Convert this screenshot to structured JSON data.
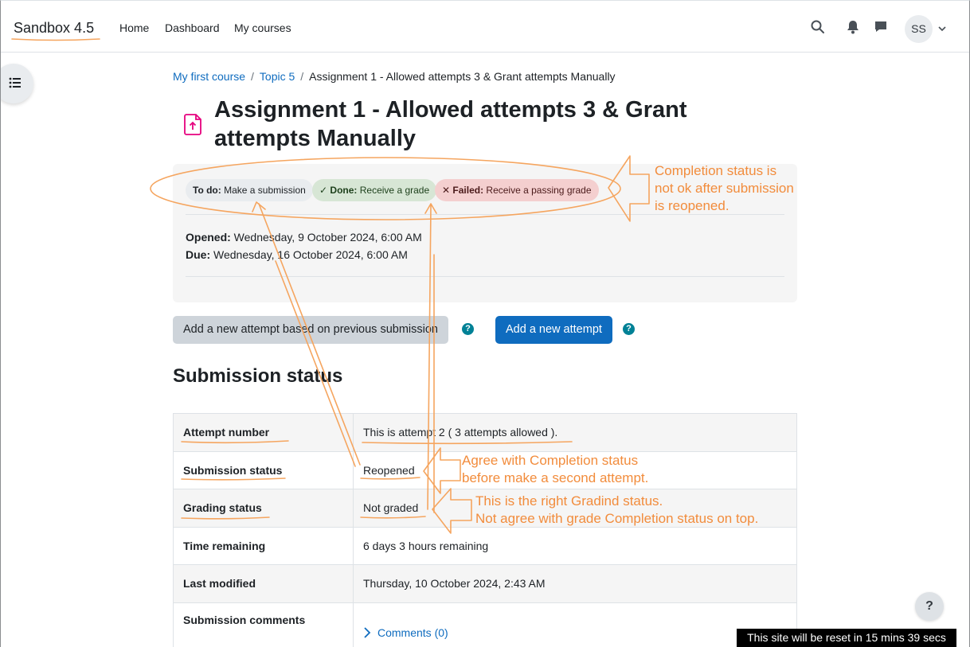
{
  "navbar": {
    "brand": "Sandbox 4.5",
    "links": [
      "Home",
      "Dashboard",
      "My courses"
    ],
    "avatar_initials": "SS"
  },
  "breadcrumb": {
    "items": [
      "My first course",
      "Topic 5"
    ],
    "current": "Assignment 1 - Allowed attempts 3 & Grant attempts Manually"
  },
  "page": {
    "title": "Assignment 1 - Allowed attempts 3 & Grant attempts Manually"
  },
  "completion": {
    "todo": {
      "label": "To do:",
      "text": "Make a submission"
    },
    "done": {
      "label": "Done:",
      "text": "Receive a grade"
    },
    "failed": {
      "label": "Failed:",
      "text": "Receive a passing grade"
    }
  },
  "dates": {
    "opened_label": "Opened:",
    "opened_value": "Wednesday, 9 October 2024, 6:00 AM",
    "due_label": "Due:",
    "due_value": "Wednesday, 16 October 2024, 6:00 AM"
  },
  "buttons": {
    "attempt_previous": "Add a new attempt based on previous submission",
    "attempt_new": "Add a new attempt",
    "help": "?"
  },
  "submission": {
    "heading": "Submission status",
    "rows": [
      {
        "label": "Attempt number",
        "value": "This is attempt 2 ( 3 attempts allowed )."
      },
      {
        "label": "Submission status",
        "value": "Reopened"
      },
      {
        "label": "Grading status",
        "value": "Not graded"
      },
      {
        "label": "Time remaining",
        "value": "6 days 3 hours remaining"
      },
      {
        "label": "Last modified",
        "value": "Thursday, 10 October 2024, 2:43 AM"
      },
      {
        "label": "Submission comments",
        "value": "Comments (0)"
      }
    ]
  },
  "footer": {
    "help": "?",
    "reset_notice": "This site will be reset in 15 mins 39 secs"
  },
  "annotations": {
    "completion_note": [
      "Completion status is",
      "not ok after submission",
      "is reopened."
    ],
    "agree_note": [
      "Agree with Completion status",
      "before make a second attempt."
    ],
    "grading_note": [
      "This is the right Gradind status.",
      "Not agree with grade Completion status on top."
    ]
  },
  "colors": {
    "primary": "#0f6cbf",
    "annotation": "#f28c3c",
    "done_badge": "#d7e6d5",
    "failed_badge": "#f4cfcf"
  }
}
